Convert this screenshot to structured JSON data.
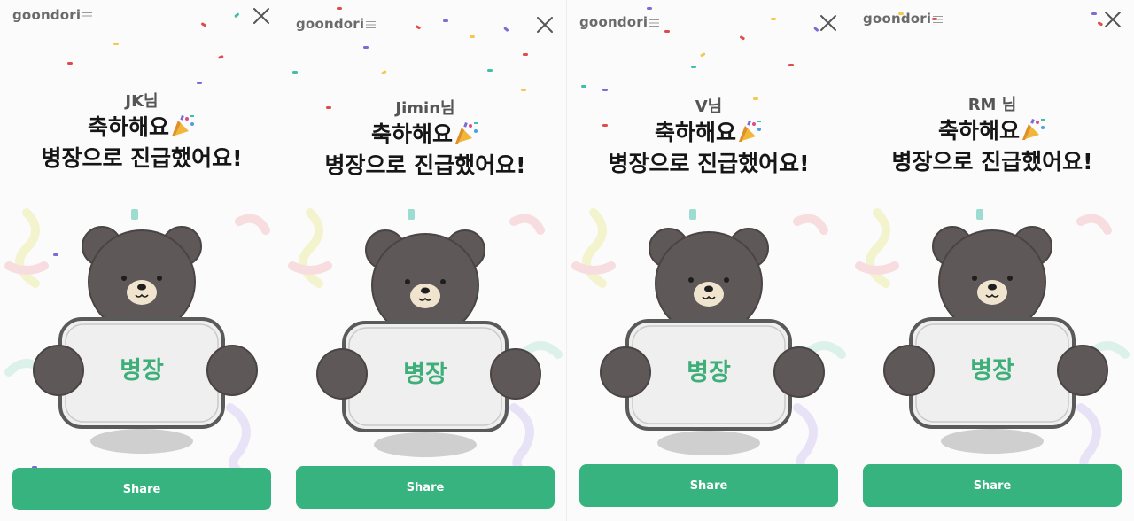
{
  "panels": [
    {
      "logo": "goondori",
      "greeting": "JK님",
      "headline_line1": "축하해요",
      "headline_line2": "병장으로 진급했어요!",
      "rank_sign": "병장",
      "share_label": "Share"
    },
    {
      "logo": "goondori",
      "greeting": "Jimin님",
      "headline_line1": "축하해요",
      "headline_line2": "병장으로 진급했어요!",
      "rank_sign": "병장",
      "share_label": "Share"
    },
    {
      "logo": "goondori",
      "greeting": "V님",
      "headline_line1": "축하해요",
      "headline_line2": "병장으로 진급했어요!",
      "rank_sign": "병장",
      "share_label": "Share"
    },
    {
      "logo": "goondori",
      "greeting": "RM 님",
      "headline_line1": "축하해요",
      "headline_line2": "병장으로 진급했어요!",
      "rank_sign": "병장",
      "share_label": "Share"
    }
  ],
  "colors": {
    "accent": "#36b37e",
    "sign_text": "#3faf7a",
    "bear_fur": "#5f5858",
    "sign_fill": "#efefef"
  },
  "icons": [
    "close-icon",
    "party-popper-icon",
    "confetti-decoration"
  ]
}
